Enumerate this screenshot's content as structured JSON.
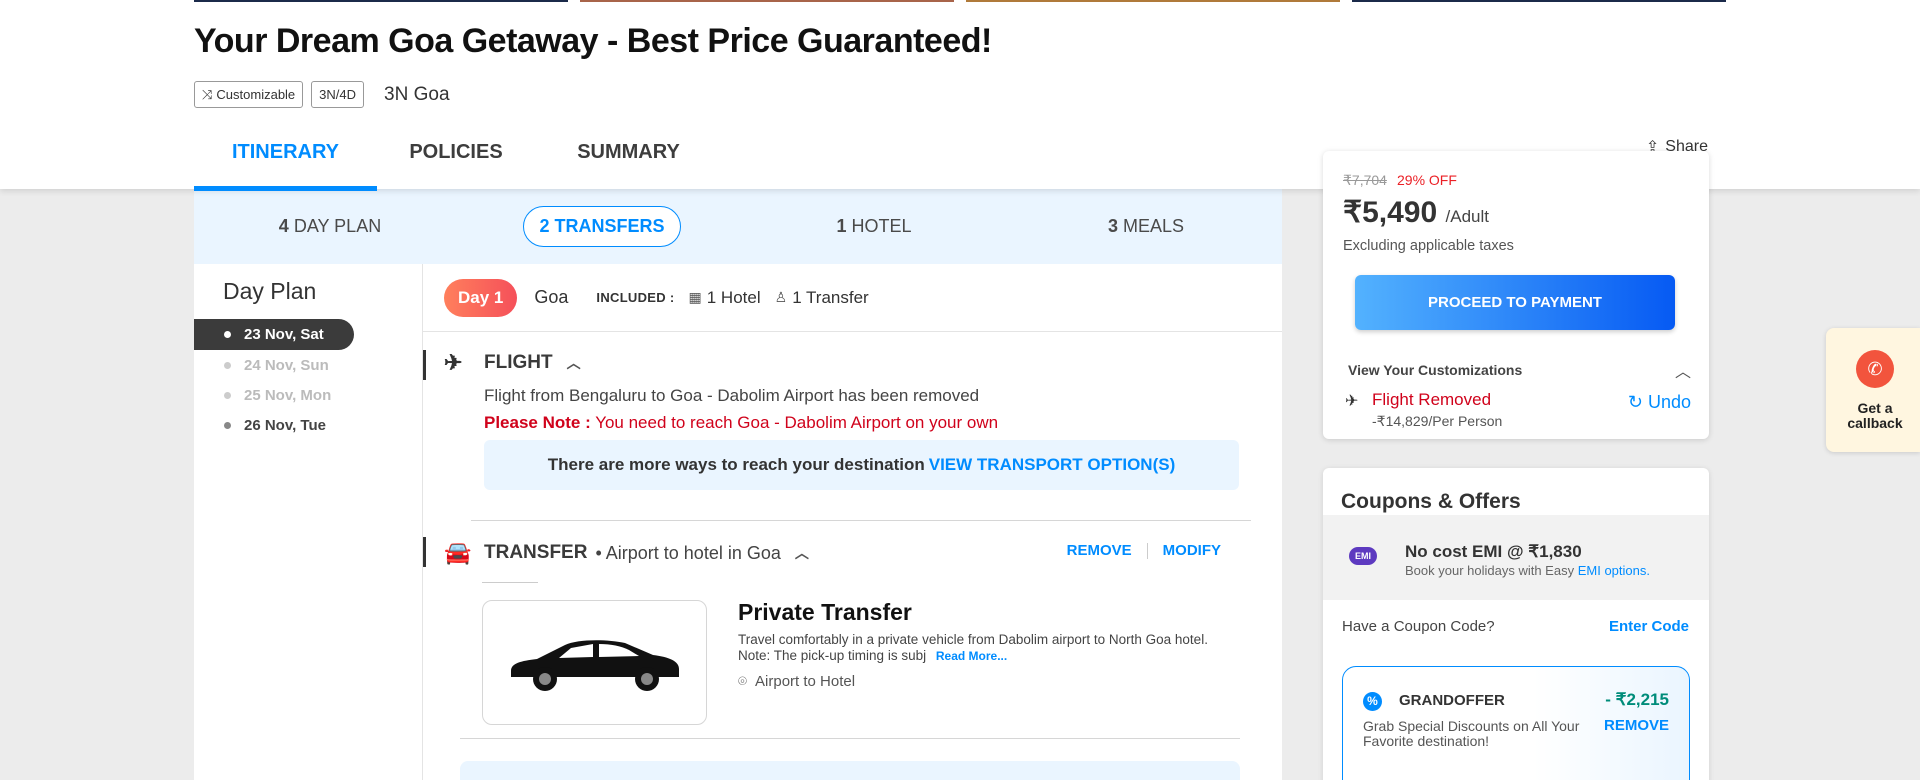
{
  "header": {
    "title": "Your Dream Goa Getaway - Best Price Guaranteed!",
    "tags": [
      "Customizable",
      "3N/4D"
    ],
    "destination": "3N Goa",
    "tabs": [
      "ITINERARY",
      "POLICIES",
      "SUMMARY"
    ],
    "active_tab": "ITINERARY",
    "share_label": "Share"
  },
  "summary_bar": {
    "day_plan": {
      "count": "4",
      "label": "DAY PLAN"
    },
    "transfers": {
      "count": "2",
      "label": "TRANSFERS"
    },
    "hotel": {
      "count": "1",
      "label": "HOTEL"
    },
    "meals": {
      "count": "3",
      "label": "MEALS"
    }
  },
  "day_plan": {
    "title": "Day Plan",
    "days": [
      "23 Nov, Sat",
      "24 Nov, Sun",
      "25 Nov, Mon",
      "26 Nov, Tue"
    ]
  },
  "day1": {
    "badge": "Day 1",
    "city": "Goa",
    "included_label": "INCLUDED :",
    "included_hotel": "1 Hotel",
    "included_transfer": "1 Transfer"
  },
  "flight": {
    "heading": "FLIGHT",
    "removed_text": "Flight from Bengaluru to Goa - Dabolim Airport has been removed",
    "note_label": "Please Note :",
    "note_text": "You need to reach Goa - Dabolim Airport on your own",
    "transport_text": "There are more ways to reach your destination",
    "transport_link": "VIEW TRANSPORT OPTION(S)"
  },
  "transfer": {
    "heading": "TRANSFER",
    "sub": "Airport to hotel in Goa",
    "remove": "REMOVE",
    "modify": "MODIFY",
    "title": "Private Transfer",
    "desc": "Travel comfortably in a private vehicle from Dabolim airport to North Goa hotel. Note: The pick-up timing is subj",
    "read_more": "Read More...",
    "location": "Airport to Hotel"
  },
  "price_card": {
    "original_price": "₹7,704",
    "discount": "29% OFF",
    "price": "₹5,490",
    "per": "/Adult",
    "taxes": "Excluding applicable taxes",
    "pay_button": "PROCEED TO PAYMENT",
    "customizations_title": "View Your Customizations",
    "removed_title": "Flight Removed",
    "removed_price": "-₹14,829/Per Person",
    "undo": "Undo"
  },
  "coupons": {
    "title": "Coupons & Offers",
    "emi_badge": "EMI",
    "emi_title": "No cost EMI @ ₹1,830",
    "emi_sub": "Book your holidays with Easy",
    "emi_link": "EMI options.",
    "coupon_label": "Have a Coupon Code?",
    "enter_code": "Enter Code",
    "offer_code": "GRANDOFFER",
    "offer_amount": "- ₹2,215",
    "offer_desc": "Grab Special Discounts on All Your Favorite destination!",
    "offer_remove": "REMOVE"
  },
  "callback": {
    "label": "Get a callback"
  },
  "colors": {
    "accent": "#008cff",
    "alert": "#d0021b",
    "day_badge": "#f5505a"
  }
}
